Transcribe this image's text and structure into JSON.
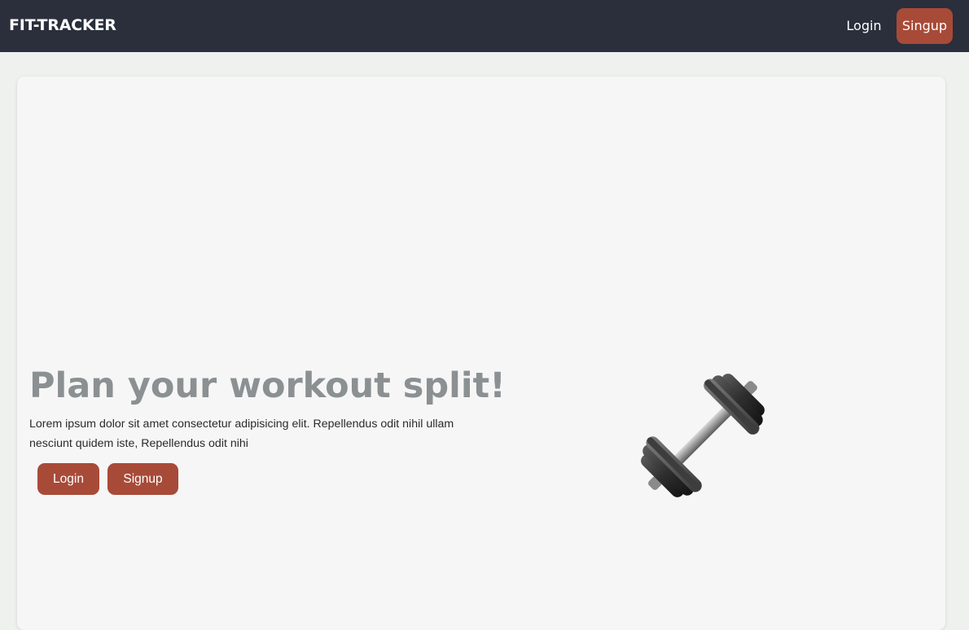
{
  "navbar": {
    "brand": "FIT-TRACKER",
    "login_label": "Login",
    "signup_label": "Singup"
  },
  "hero": {
    "title": "Plan your workout split!",
    "description": "Lorem ipsum dolor sit amet consectetur adipisicing elit. Repellendus odit nihil ullam nesciunt quidem iste, Repellendus odit nihi",
    "login_label": "Login",
    "signup_label": "Signup",
    "image_icon": "dumbbell-icon"
  },
  "colors": {
    "navbar_bg": "#2a2f3b",
    "accent": "#a84a38",
    "title": "#8b9092",
    "page_bg": "#eff1ef",
    "card_bg": "#f6f6f6"
  }
}
